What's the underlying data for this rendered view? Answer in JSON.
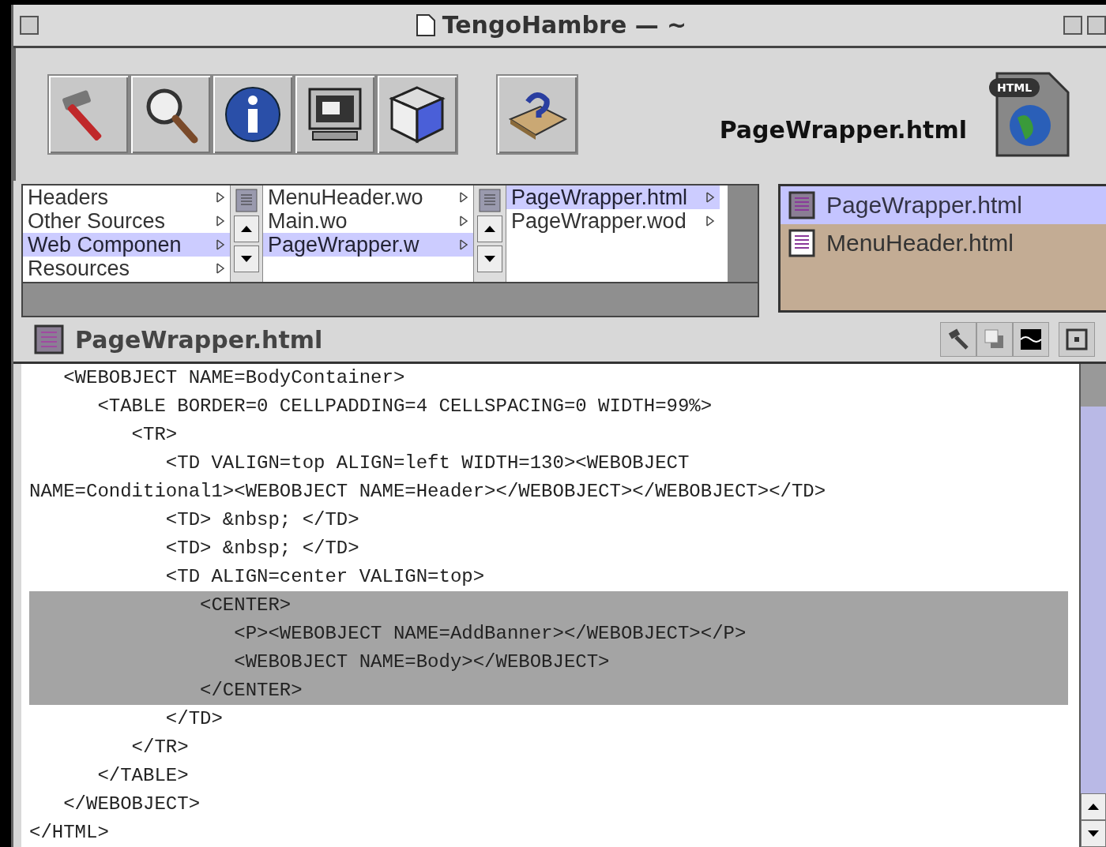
{
  "window": {
    "title": "TengoHambre — ~"
  },
  "toolbar": {
    "file_label": "PageWrapper.html",
    "file_badge": "HTML"
  },
  "browser": {
    "columns": [
      {
        "items": [
          {
            "label": "Headers",
            "selected": false
          },
          {
            "label": "Other Sources",
            "selected": false
          },
          {
            "label": "Web Componen",
            "selected": true
          },
          {
            "label": "Resources",
            "selected": false
          }
        ]
      },
      {
        "items": [
          {
            "label": "MenuHeader.wo",
            "selected": false
          },
          {
            "label": "Main.wo",
            "selected": false
          },
          {
            "label": "PageWrapper.w",
            "selected": true
          }
        ]
      },
      {
        "items": [
          {
            "label": "PageWrapper.html",
            "selected": true
          },
          {
            "label": "PageWrapper.wod",
            "selected": false
          }
        ]
      }
    ]
  },
  "open_files": [
    {
      "label": "PageWrapper.html",
      "selected": true
    },
    {
      "label": "MenuHeader.html",
      "selected": false
    }
  ],
  "editor": {
    "title": "PageWrapper.html",
    "lines": [
      {
        "text": "   <WEBOBJECT NAME=BodyContainer>",
        "selected": false
      },
      {
        "text": "      <TABLE BORDER=0 CELLPADDING=4 CELLSPACING=0 WIDTH=99%>",
        "selected": false
      },
      {
        "text": "         <TR>",
        "selected": false
      },
      {
        "text": "            <TD VALIGN=top ALIGN=left WIDTH=130><WEBOBJECT",
        "selected": false
      },
      {
        "text": "NAME=Conditional1><WEBOBJECT NAME=Header></WEBOBJECT></WEBOBJECT></TD>",
        "selected": false
      },
      {
        "text": "            <TD> &nbsp; </TD>",
        "selected": false
      },
      {
        "text": "            <TD> &nbsp; </TD>",
        "selected": false
      },
      {
        "text": "            <TD ALIGN=center VALIGN=top>",
        "selected": false
      },
      {
        "text": "               <CENTER>",
        "selected": true
      },
      {
        "text": "                  <P><WEBOBJECT NAME=AddBanner></WEBOBJECT></P>",
        "selected": true
      },
      {
        "text": "                  <WEBOBJECT NAME=Body></WEBOBJECT>",
        "selected": true
      },
      {
        "text": "               </CENTER>",
        "selected": true
      },
      {
        "text": "            </TD>",
        "selected": false
      },
      {
        "text": "         </TR>",
        "selected": false
      },
      {
        "text": "      </TABLE>",
        "selected": false
      },
      {
        "text": "   </WEBOBJECT>",
        "selected": false
      },
      {
        "text": "</HTML>",
        "selected": false
      }
    ]
  }
}
